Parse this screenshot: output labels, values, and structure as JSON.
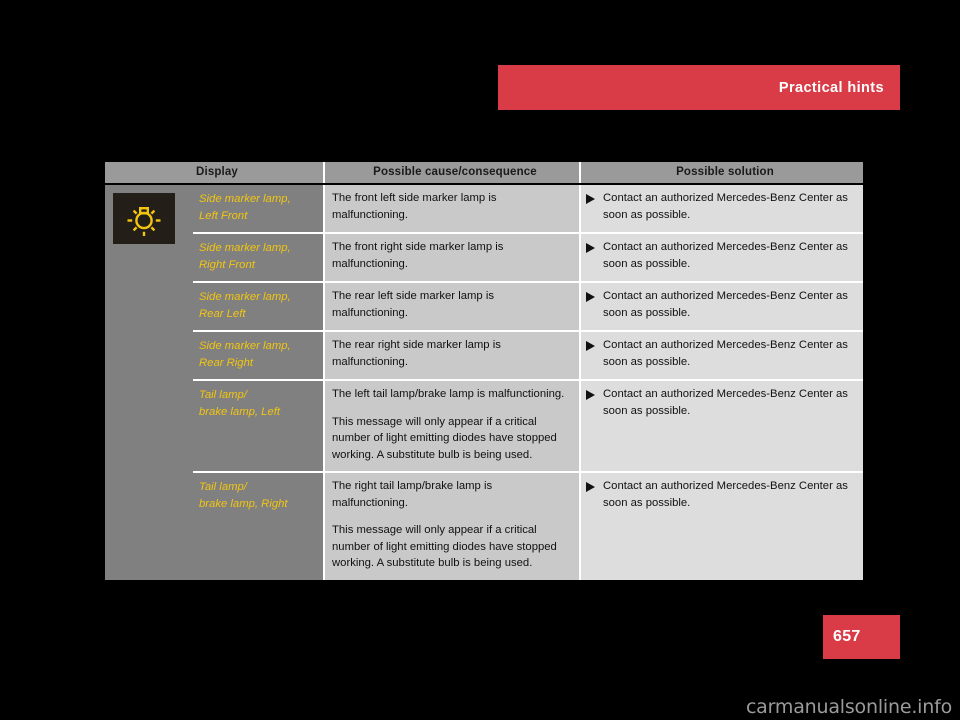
{
  "header": {
    "title": "Practical hints",
    "accent_color": "#d93c46"
  },
  "table": {
    "columns": [
      {
        "key": "display",
        "label": "Display"
      },
      {
        "key": "cause",
        "label": "Possible cause/consequence"
      },
      {
        "key": "solution",
        "label": "Possible solution"
      }
    ],
    "icon": {
      "name": "lamp-indicator-icon",
      "background": "#231f18",
      "color": "#f2c511"
    },
    "rows": [
      {
        "display_line1": "Side marker lamp,",
        "display_line2": "Left Front",
        "cause": [
          "The front left side marker lamp is malfunctioning."
        ],
        "solution": [
          "Contact an authorized Mercedes-Benz Center as soon as possible."
        ]
      },
      {
        "display_line1": "Side marker lamp,",
        "display_line2": "Right Front",
        "cause": [
          "The front right side marker lamp is malfunctioning."
        ],
        "solution": [
          "Contact an authorized Mercedes-Benz Center as soon as possible."
        ]
      },
      {
        "display_line1": "Side marker lamp,",
        "display_line2": "Rear Left",
        "cause": [
          "The rear left side marker lamp is malfunctioning."
        ],
        "solution": [
          "Contact an authorized Mercedes-Benz Center as soon as possible."
        ]
      },
      {
        "display_line1": "Side marker lamp,",
        "display_line2": "Rear Right",
        "cause": [
          "The rear right side marker lamp is malfunctioning."
        ],
        "solution": [
          "Contact an authorized Mercedes-Benz Center as soon as possible."
        ]
      },
      {
        "display_line1": "Tail lamp/",
        "display_line2": "brake lamp, Left",
        "cause": [
          "The left tail lamp/brake lamp is malfunctioning.",
          "This message will only appear if a critical number of light emitting diodes have stopped working. A substitute bulb is being used."
        ],
        "solution": [
          "Contact an authorized Mercedes-Benz Center as soon as possible."
        ]
      },
      {
        "display_line1": "Tail lamp/",
        "display_line2": "brake lamp, Right",
        "cause": [
          "The right tail lamp/brake lamp is malfunctioning.",
          "This message will only appear if a critical number of light emitting diodes have stopped working. A substitute bulb is being used."
        ],
        "solution": [
          "Contact an authorized Mercedes-Benz Center as soon as possible."
        ]
      }
    ]
  },
  "footer": {
    "page_number": "657",
    "watermark": "carmanualsonline.info"
  }
}
